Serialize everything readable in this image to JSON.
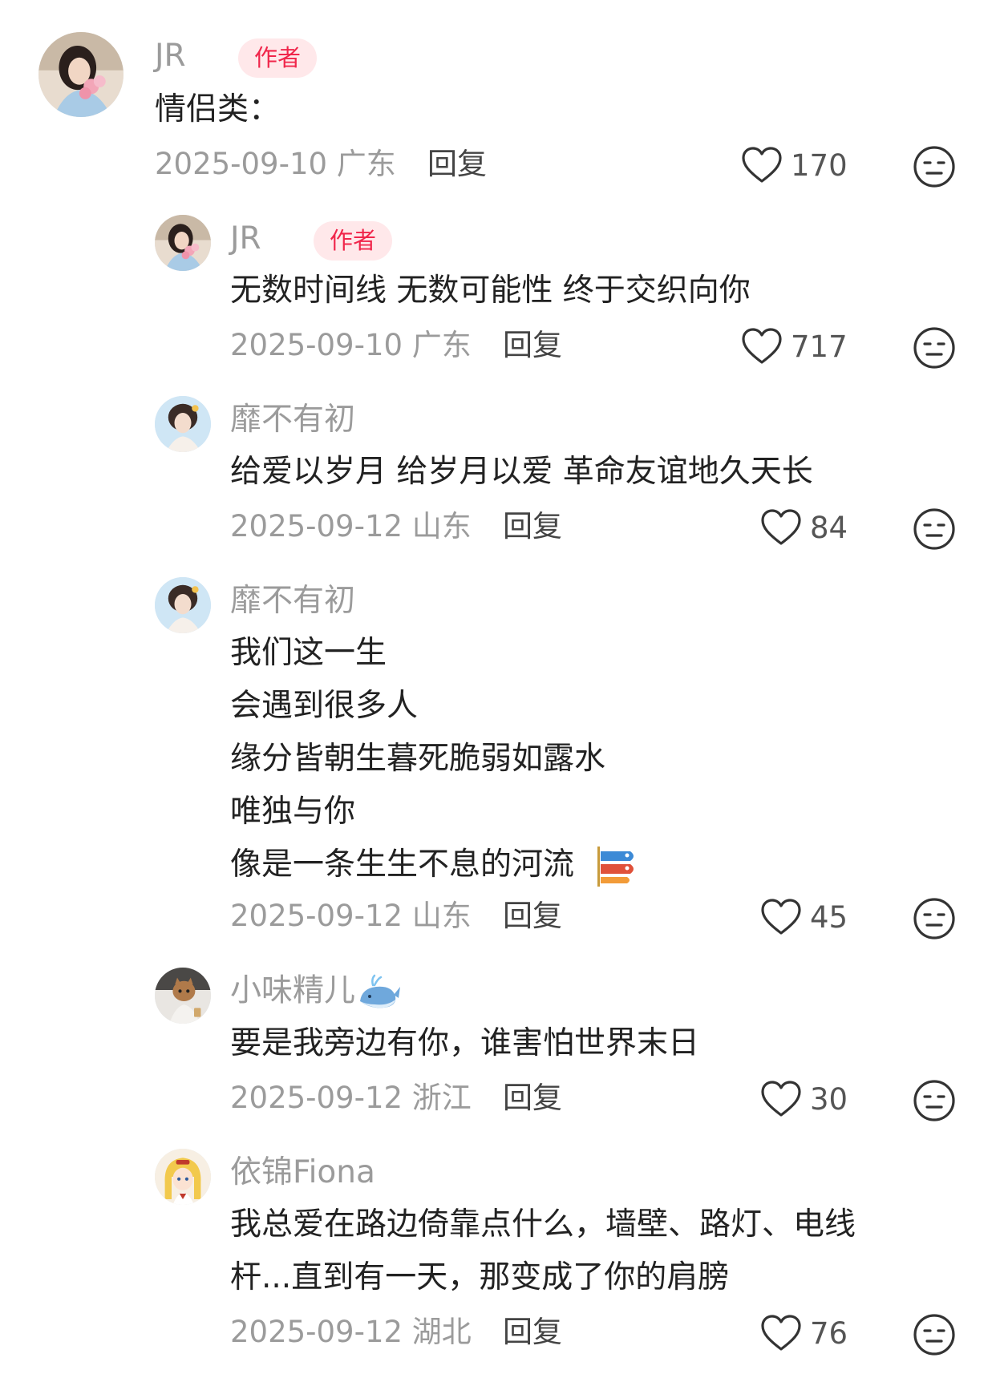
{
  "comments": [
    {
      "username": "JR",
      "badge": "作者",
      "lines": [
        "情侣类："
      ],
      "date": "2025-09-10",
      "location": "广东",
      "reply_label": "回复",
      "likes": "170"
    },
    {
      "username": "JR",
      "badge": "作者",
      "lines": [
        "无数时间线 无数可能性 终于交织向你"
      ],
      "date": "2025-09-10",
      "location": "广东",
      "reply_label": "回复",
      "likes": "717"
    },
    {
      "username": "靡不有初",
      "lines": [
        "给爱以岁月 给岁月以爱 革命友谊地久天长"
      ],
      "date": "2025-09-12",
      "location": "山东",
      "reply_label": "回复",
      "likes": "84"
    },
    {
      "username": "靡不有初",
      "lines": [
        "我们这一生",
        "会遇到很多人",
        "缘分皆朝生暮死脆弱如露水",
        "唯独与你",
        "像是一条生生不息的河流"
      ],
      "date": "2025-09-12",
      "location": "山东",
      "reply_label": "回复",
      "likes": "45"
    },
    {
      "username": "小味精儿",
      "lines": [
        "要是我旁边有你，谁害怕世界末日"
      ],
      "date": "2025-09-12",
      "location": "浙江",
      "reply_label": "回复",
      "likes": "30"
    },
    {
      "username": "依锦Fiona",
      "lines": [
        "我总爱在路边倚靠点什么，墙壁、路灯、电线",
        "杆...直到有一天，那变成了你的肩膀"
      ],
      "date": "2025-09-12",
      "location": "湖北",
      "reply_label": "回复",
      "likes": "76"
    }
  ],
  "icons": {
    "like": "heart-outline-icon",
    "dislike": "neutral-face-icon",
    "inline_emoji": "carp-streamer-icon",
    "name_emoji": "whale-icon"
  },
  "colors": {
    "badge_text": "#f0264b",
    "badge_bg": "#ffe8ea",
    "meta": "#9b9b9b"
  }
}
